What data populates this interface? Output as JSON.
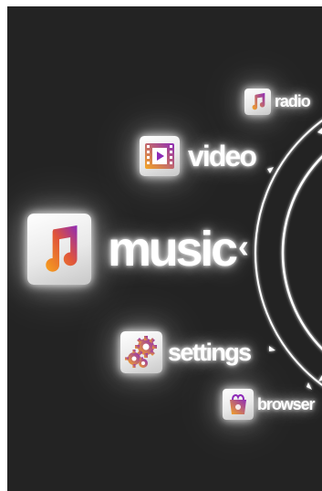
{
  "menu": {
    "items": [
      {
        "id": "radio",
        "label": "radio",
        "icon": "radio-icon",
        "selected": false
      },
      {
        "id": "video",
        "label": "video",
        "icon": "video-icon",
        "selected": false
      },
      {
        "id": "music",
        "label": "music",
        "icon": "music-icon",
        "selected": true,
        "pointer": "‹"
      },
      {
        "id": "settings",
        "label": "settings",
        "icon": "settings-icon",
        "selected": false
      },
      {
        "id": "browser",
        "label": "browser",
        "icon": "browser-icon",
        "selected": false
      }
    ]
  },
  "theme": {
    "background": "#232323",
    "text": "#ffffff",
    "icon_gradient_start": "#f5a623",
    "icon_gradient_end": "#8e2bb8"
  }
}
